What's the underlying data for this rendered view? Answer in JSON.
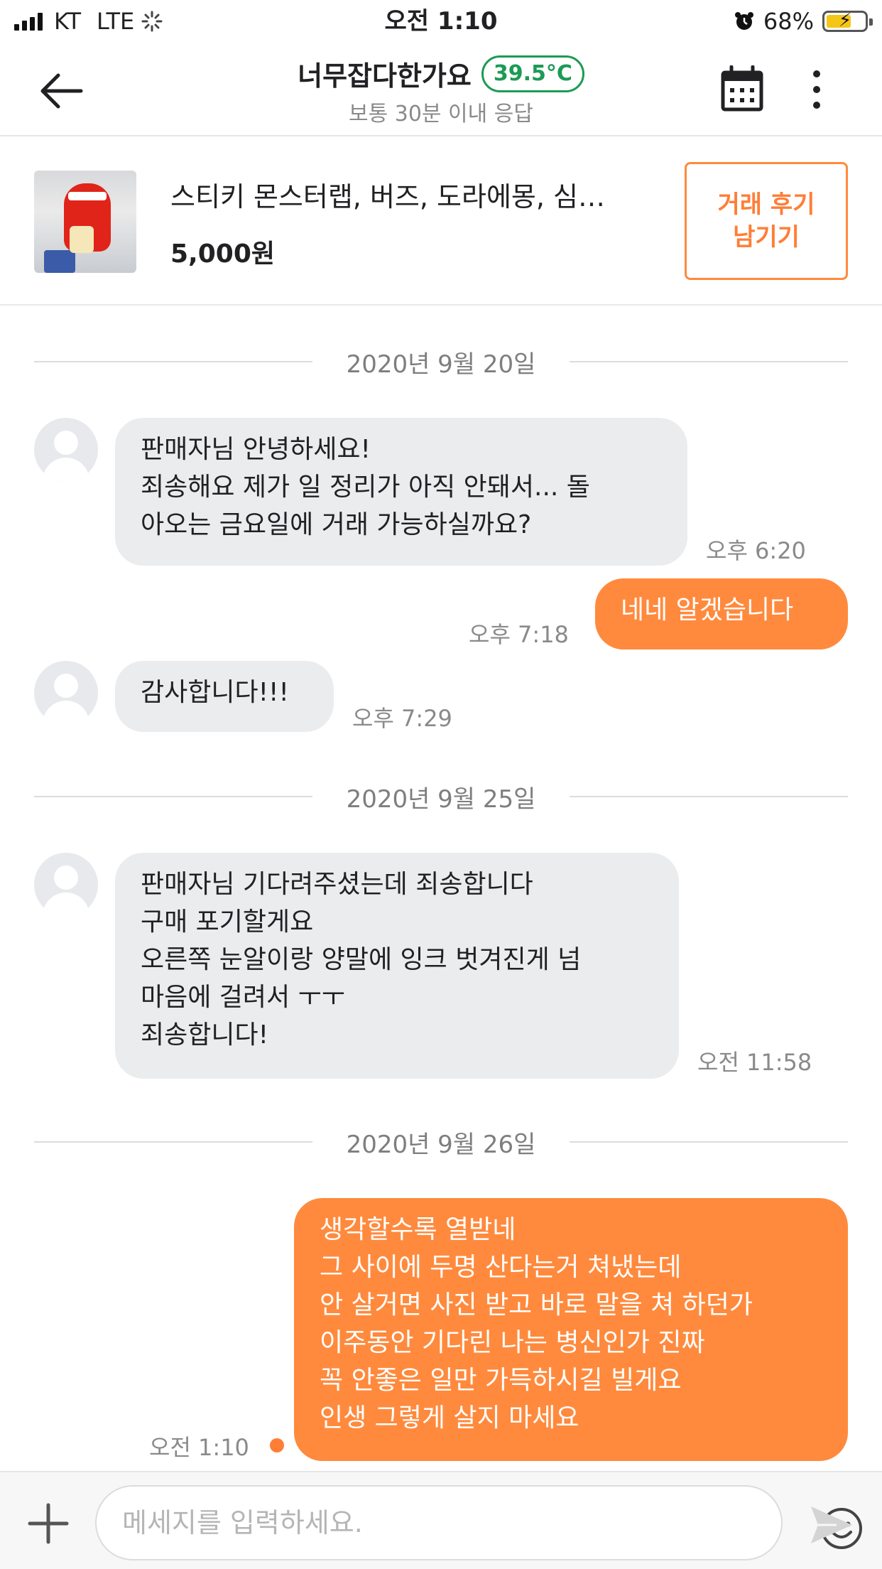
{
  "status_bar": {
    "carrier": "KT",
    "network": "LTE",
    "time": "오전 1:10",
    "battery": "68%"
  },
  "header": {
    "title": "너무잡다한가요",
    "temperature": "39.5°C",
    "subtitle": "보통 30분 이내 응답",
    "icons": [
      "back-arrow-icon",
      "calendar-icon",
      "more-vertical-icon"
    ],
    "colors": {
      "temperature": "#1c9b55"
    }
  },
  "product": {
    "name": "스티키 몬스터랩, 버즈, 도라에몽, 심…",
    "price": "5,000원",
    "review_button": "거래 후기\n남기기",
    "colors": {
      "accent": "#ff7e36"
    }
  },
  "chat": {
    "dates": [
      "2020년 9월 20일",
      "2020년 9월 25일",
      "2020년 9월 26일"
    ],
    "messages": [
      {
        "side": "in",
        "text": "판매자님 안녕하세요!\n죄송해요 제가 일 정리가 아직 안돼서... 돌\n아오는 금요일에 거래 가능하실까요?",
        "time": "오후 6:20"
      },
      {
        "side": "out",
        "text": "네네 알겠습니다",
        "time": "오후 7:18"
      },
      {
        "side": "in",
        "text": "감사합니다!!!",
        "time": "오후 7:29"
      },
      {
        "side": "in",
        "text": "판매자님 기다려주셨는데 죄송합니다\n구매 포기할게요\n오른쪽 눈알이랑 양말에 잉크 벗겨진게 넘\n마음에 걸려서 ㅜㅜ\n죄송합니다!",
        "time": "오전 11:58"
      },
      {
        "side": "out",
        "text": "생각할수록 열받네\n그 사이에 두명 산다는거 쳐냈는데\n안 살거면 사진 받고 바로 말을 쳐 하던가\n이주동안 기다린 나는 병신인가 진짜\n꼭 안좋은 일만 가득하시길 빌게요\n인생 그렇게 살지 마세요",
        "time": "오전 1:10"
      }
    ],
    "colors": {
      "incoming_bubble": "#ebecee",
      "outgoing_bubble": "#ff8a3d"
    }
  },
  "input_bar": {
    "placeholder": "메세지를 입력하세요.",
    "value": "",
    "icons": [
      "plus-icon",
      "emoji-icon",
      "send-icon"
    ]
  }
}
